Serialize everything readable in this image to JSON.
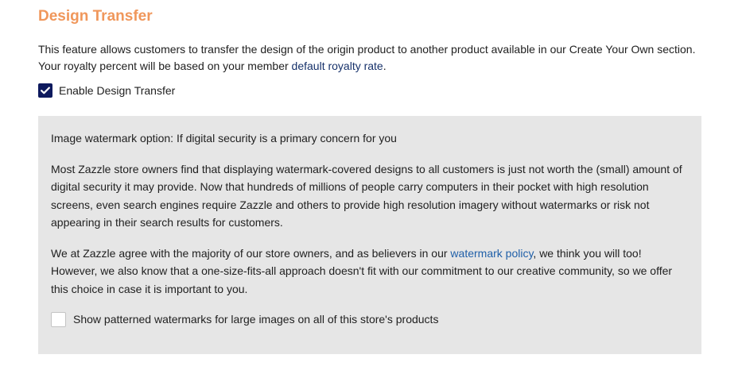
{
  "title": "Design Transfer",
  "intro": {
    "line1": "This feature allows customers to transfer the design of the origin product to another product available in our Create Your Own section.",
    "line2_prefix": "Your royalty percent will be based on your member ",
    "royalty_link": "default royalty rate",
    "line2_suffix": "."
  },
  "enable_transfer": {
    "label": "Enable Design Transfer",
    "checked": true
  },
  "watermark_panel": {
    "lead": "Image watermark option: If digital security is a primary concern for you",
    "para1": "Most Zazzle store owners find that displaying watermark-covered designs to all customers is just not worth the (small) amount of digital security it may provide. Now that hundreds of millions of people carry computers in their pocket with high resolution screens, even search engines require Zazzle and others to provide high resolution imagery without watermarks or risk not appearing in their search results for customers.",
    "para2_prefix": "We at Zazzle agree with the majority of our store owners, and as believers in our ",
    "policy_link": "watermark policy",
    "para2_suffix": ", we think you will too! However, we also know that a one-size-fits-all approach doesn't fit with our commitment to our creative community, so we offer this choice in case it is important to you.",
    "checkbox_label": "Show patterned watermarks for large images on all of this store's products",
    "checked": false
  },
  "colors": {
    "title": "#f0975b",
    "checkbox_checked": "#0e1a5e",
    "panel_bg": "#e6e6e6",
    "link": "#1f5fa8"
  }
}
